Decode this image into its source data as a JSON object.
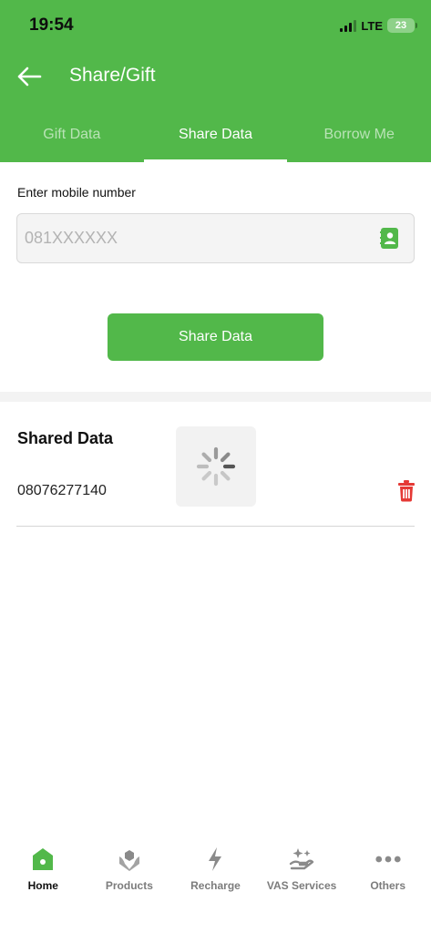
{
  "status_bar": {
    "time": "19:54",
    "network": "LTE",
    "battery": "23"
  },
  "header": {
    "title": "Share/Gift"
  },
  "tabs": [
    {
      "label": "Gift Data",
      "active": false
    },
    {
      "label": "Share Data",
      "active": true
    },
    {
      "label": "Borrow Me",
      "active": false
    }
  ],
  "form": {
    "mobile_label": "Enter mobile number",
    "mobile_placeholder": "081XXXXXX",
    "mobile_value": "",
    "submit_label": "Share Data"
  },
  "shared": {
    "title": "Shared Data",
    "number": "08076277140"
  },
  "bottom_nav": [
    {
      "label": "Home",
      "icon": "home-icon",
      "active": true
    },
    {
      "label": "Products",
      "icon": "products-icon",
      "active": false
    },
    {
      "label": "Recharge",
      "icon": "lightning-icon",
      "active": false
    },
    {
      "label": "VAS Services",
      "icon": "vas-icon",
      "active": false
    },
    {
      "label": "Others",
      "icon": "more-dots-icon",
      "active": false
    }
  ],
  "colors": {
    "brand": "#52b84a",
    "danger": "#e53935",
    "muted": "#7c7c7c"
  }
}
